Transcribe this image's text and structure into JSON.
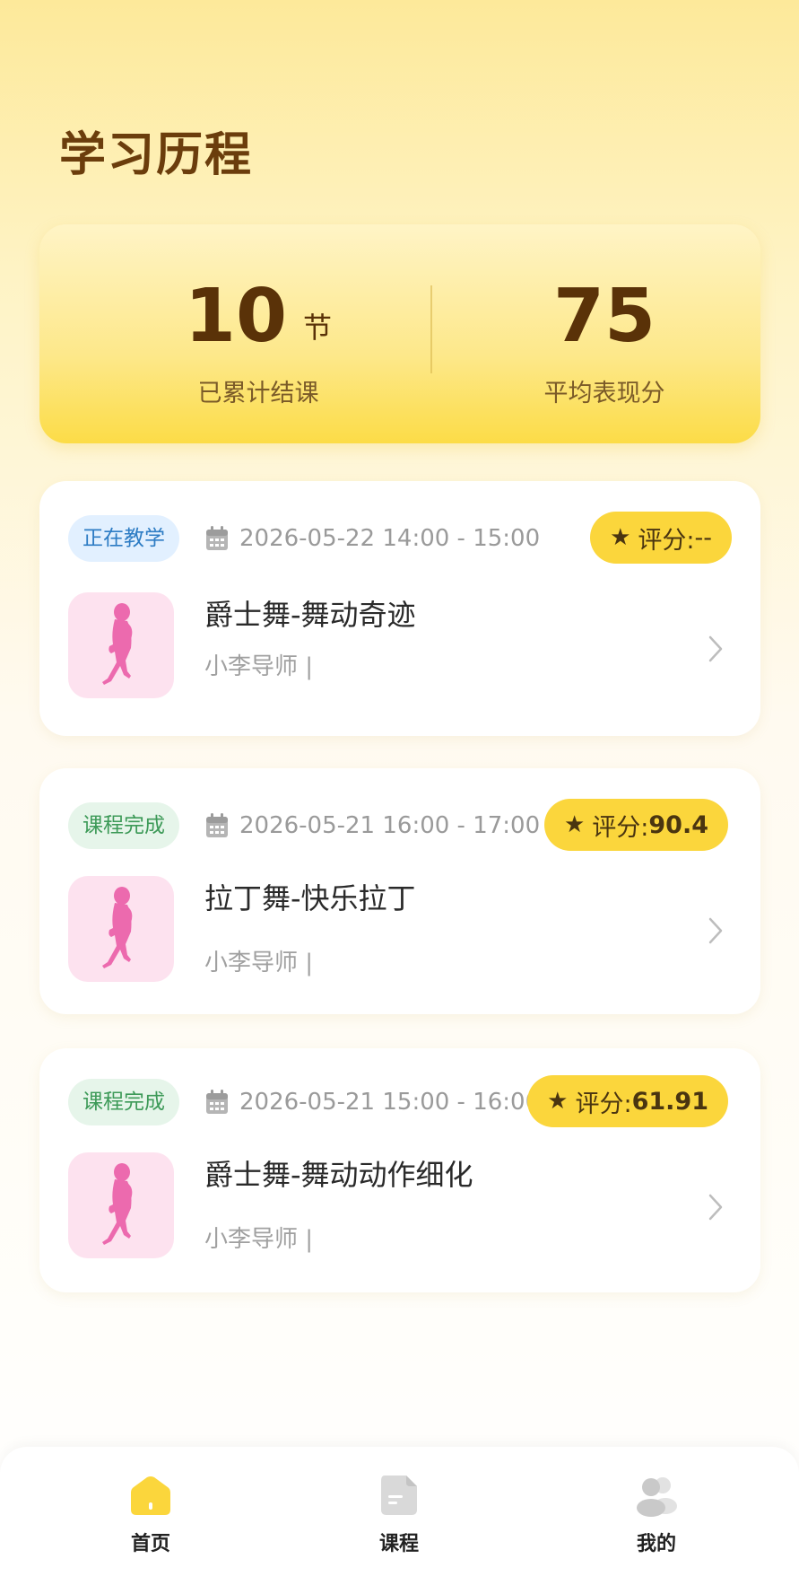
{
  "page": {
    "title": "学习历程"
  },
  "summary": {
    "classes_count": "10",
    "classes_unit": "节",
    "classes_label": "已累计结课",
    "avg_score": "75",
    "avg_label": "平均表现分"
  },
  "courses": [
    {
      "status": "正在教学",
      "date": "2026-05-22 14:00 - 15:00",
      "score_prefix": "评分:",
      "score_value": "--",
      "title": "爵士舞-舞动奇迹",
      "teacher": "小李导师 |"
    },
    {
      "status": "课程完成",
      "date": "2026-05-21 16:00 - 17:00",
      "score_prefix": "评分:",
      "score_value": "90.4",
      "title": "拉丁舞-快乐拉丁",
      "teacher": "小李导师 |"
    },
    {
      "status": "课程完成",
      "date": "2026-05-21 15:00 - 16:00",
      "score_prefix": "评分:",
      "score_value": "61.91",
      "title": "爵士舞-舞动动作细化",
      "teacher": "小李导师 |"
    }
  ],
  "tabs": [
    {
      "label": "首页",
      "icon": "home-icon",
      "active": true
    },
    {
      "label": "课程",
      "icon": "document-icon",
      "active": false
    },
    {
      "label": "我的",
      "icon": "users-icon",
      "active": false
    }
  ],
  "colors": {
    "accent": "#fbd63c",
    "title_brown": "#6b3d0c",
    "thumb_pink": "#fde2ef",
    "dancer_pink": "#ec6aae"
  }
}
